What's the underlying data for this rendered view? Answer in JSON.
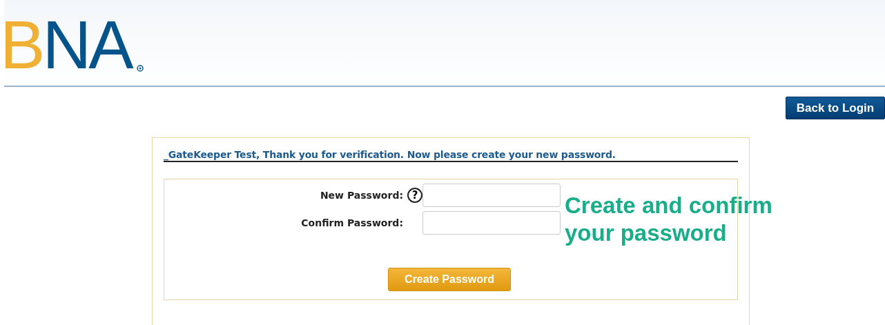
{
  "logo": [
    {
      "text": "B",
      "color": "#f0b034"
    },
    {
      "text": "NA",
      "color": "#04538a"
    }
  ],
  "back_button": "Back to Login",
  "message": "_GateKeeper Test, Thank you for verification. Now please create your new password.",
  "fields": [
    {
      "label": "New Password:",
      "help": "?"
    },
    {
      "label": "Confirm Password:"
    }
  ],
  "submit_button": "Create Password",
  "annotation": "Create and confirm your password"
}
